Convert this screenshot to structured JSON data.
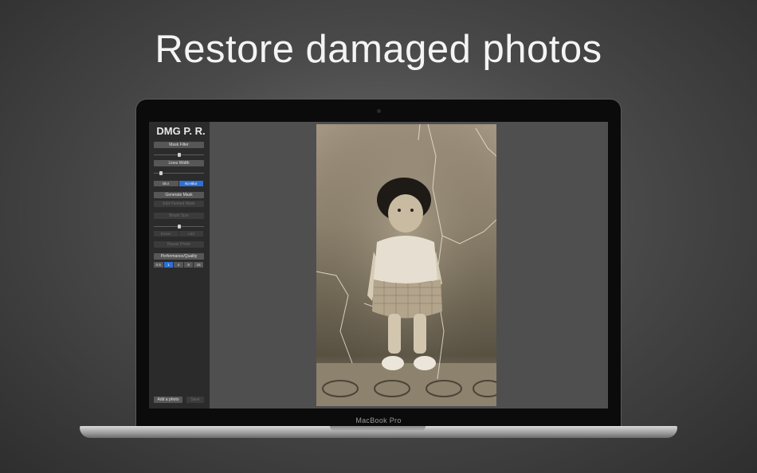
{
  "headline": "Restore damaged photos",
  "device_label": "MacBook Pro",
  "app": {
    "title": "DMG P. R.",
    "mask_filter_label": "Mask Filter",
    "lines_width_label": "Lines Width",
    "blur_options": [
      "Blur",
      "No-Blur"
    ],
    "blur_selected": "No-Blur",
    "generate_mask_label": "Generate Mask",
    "edit_mask_label": "Edit Painted Mask",
    "brush_size_label": "Brush Size",
    "paint_options": [
      "Eraser",
      "Add"
    ],
    "repair_photo_label": "Repair Photo",
    "performance_label": "Performance/Quality",
    "quality_options": [
      "0.5",
      "1",
      "4",
      "8",
      "16"
    ],
    "quality_selected": "1",
    "add_photo_label": "Add a photo",
    "save_label": "Save"
  },
  "colors": {
    "accent": "#2f6fd6",
    "sepia_light": "#a39682",
    "sepia_dark": "#585142"
  }
}
